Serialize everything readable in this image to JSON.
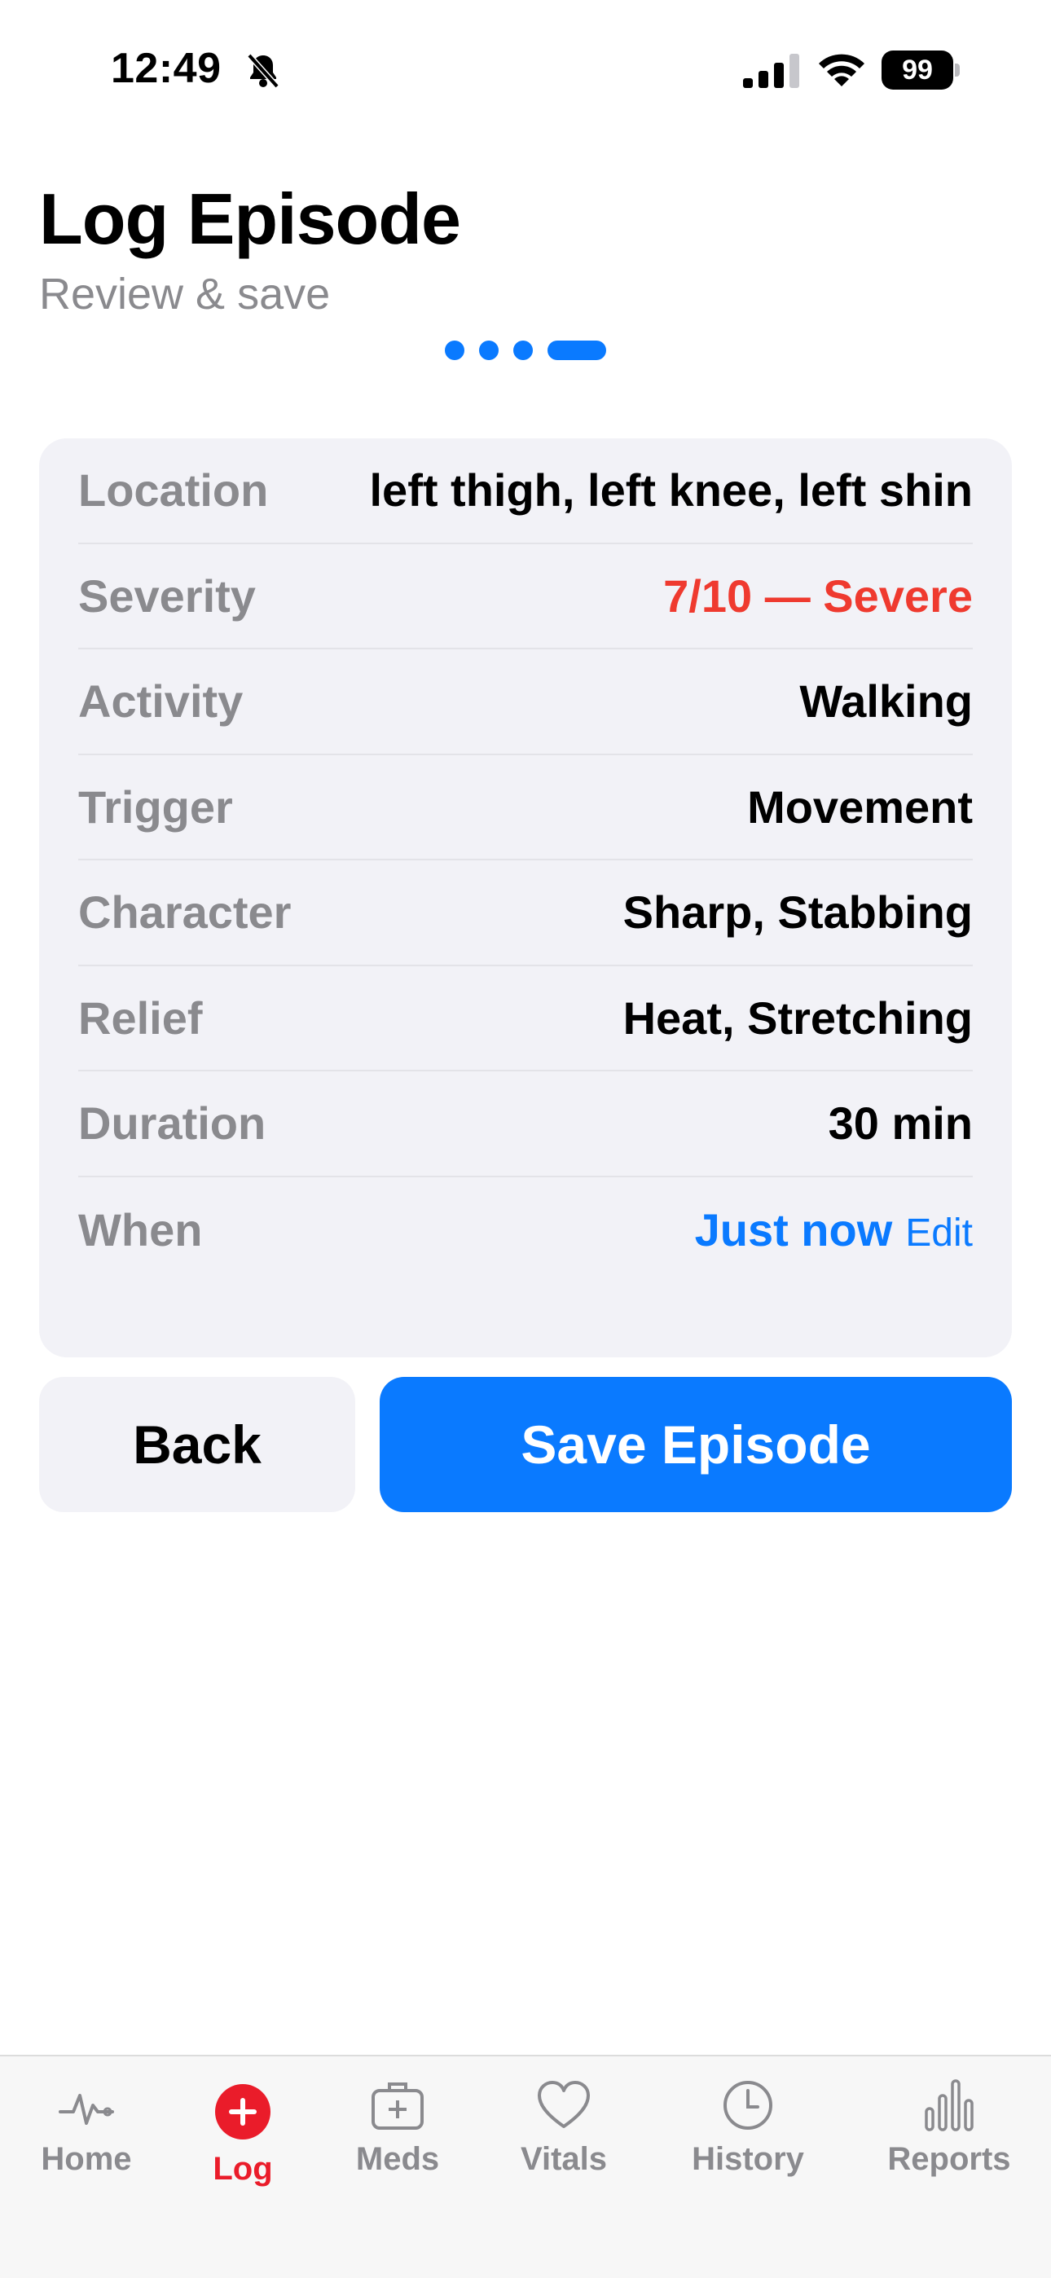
{
  "status_bar": {
    "time": "12:49",
    "battery": "99"
  },
  "header": {
    "title": "Log Episode",
    "subtitle": "Review & save",
    "steps_total": 4,
    "step_current": 4
  },
  "summary": {
    "rows": [
      {
        "label": "Location",
        "value": "left thigh, left knee, left shin"
      },
      {
        "label": "Severity",
        "value": "7/10 — Severe"
      },
      {
        "label": "Activity",
        "value": "Walking"
      },
      {
        "label": "Trigger",
        "value": "Movement"
      },
      {
        "label": "Character",
        "value": "Sharp, Stabbing"
      },
      {
        "label": "Relief",
        "value": "Heat, Stretching"
      },
      {
        "label": "Duration",
        "value": "30 min"
      },
      {
        "label": "When",
        "value": "Just now",
        "action": "Edit"
      }
    ]
  },
  "actions": {
    "back_label": "Back",
    "save_label": "Save Episode"
  },
  "colors": {
    "accent": "#0a7aff",
    "severe": "#ef3a2f",
    "tab_active": "#ea1c2a",
    "secondary_text": "#8a8a8e",
    "card_bg": "#f2f2f7"
  },
  "tab_bar": {
    "active": "Log",
    "items": [
      {
        "label": "Home",
        "icon": "heartbeat-icon"
      },
      {
        "label": "Log",
        "icon": "plus-circle-icon"
      },
      {
        "label": "Meds",
        "icon": "medkit-icon"
      },
      {
        "label": "Vitals",
        "icon": "heart-icon"
      },
      {
        "label": "History",
        "icon": "clock-icon"
      },
      {
        "label": "Reports",
        "icon": "bar-chart-icon"
      }
    ]
  }
}
